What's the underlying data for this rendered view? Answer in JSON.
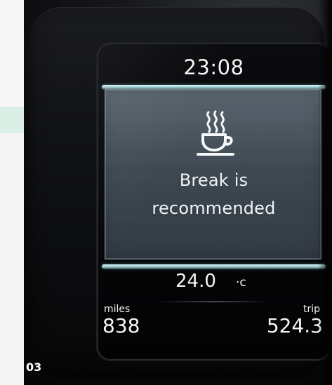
{
  "time": "23:08",
  "message": {
    "icon": "coffee-cup-icon",
    "line_1": "Break is",
    "line_2": "recommended"
  },
  "temperature": {
    "value": "24.0",
    "unit": "c"
  },
  "trip_readouts": {
    "miles_label": "miles",
    "miles_value": "838",
    "trip_label": "trip",
    "trip_value": "524.3"
  },
  "caption": "03",
  "colors": {
    "accent_bar": "#9dc7cd",
    "message_panel": "#45525c",
    "display_text": "#f4f6f7"
  }
}
